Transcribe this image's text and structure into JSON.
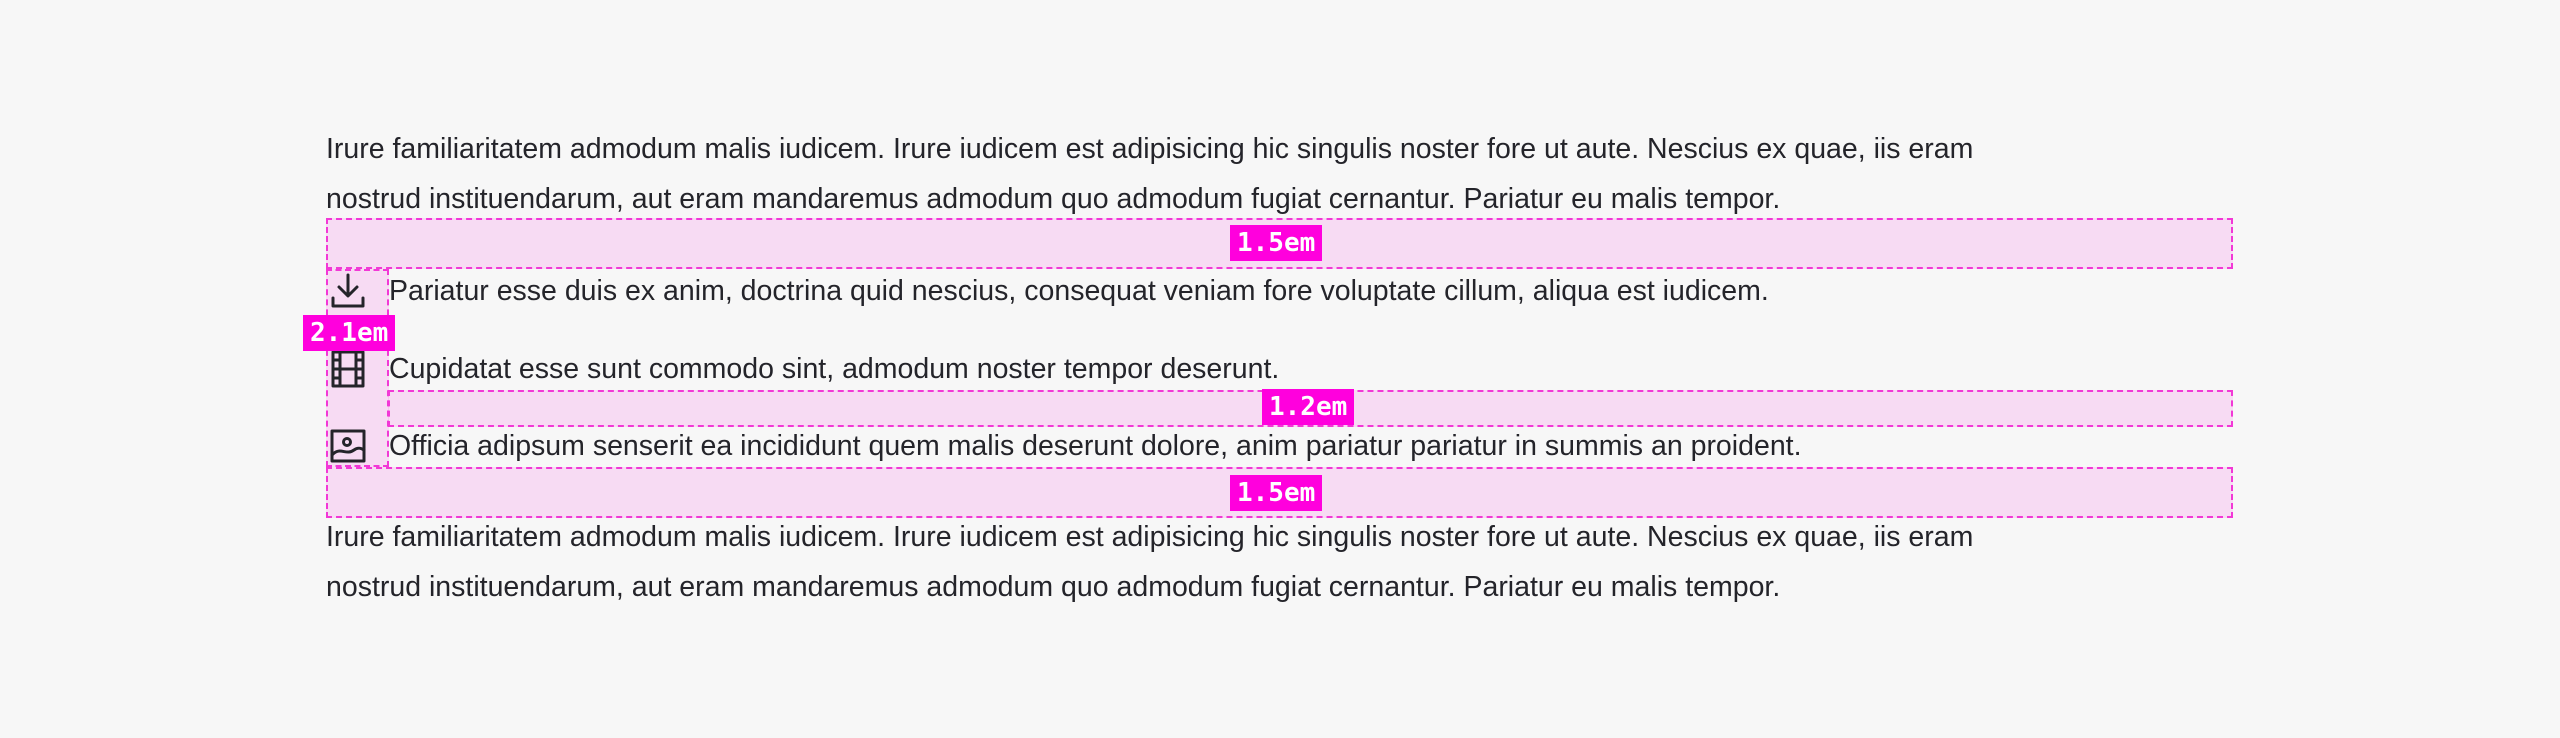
{
  "paragraphs": {
    "top": {
      "line1": "Irure familiaritatem admodum malis iudicem. Irure iudicem est adipisicing hic singulis noster fore ut aute. Nescius ex quae, iis eram",
      "line2": "nostrud instituendarum, aut eram mandaremus admodum quo admodum fugiat cernantur. Pariatur eu malis tempor."
    },
    "bottom": {
      "line1": "Irure familiaritatem admodum malis iudicem. Irure iudicem est adipisicing hic singulis noster fore ut aute. Nescius ex quae, iis eram",
      "line2": "nostrud instituendarum, aut eram mandaremus admodum quo admodum fugiat cernantur. Pariatur eu malis tempor."
    }
  },
  "list": {
    "items": [
      {
        "icon": "download-icon",
        "text": "Pariatur esse duis ex anim, doctrina quid nescius, consequat veniam fore voluptate cillum, aliqua est iudicem."
      },
      {
        "icon": "film-icon",
        "text": "Cupidatat esse sunt commodo sint, admodum noster tempor deserunt."
      },
      {
        "icon": "image-icon",
        "text": "Officia adipsum senserit ea incididunt quem malis deserunt dolore, anim pariatur pariatur in summis an proident."
      }
    ]
  },
  "spacing_labels": {
    "before_list": "1.5em",
    "icon_column": "2.1em",
    "between_items": "1.2em",
    "after_list": "1.5em"
  },
  "colors": {
    "overlay": "#ff00dd",
    "text": "#24242a",
    "background": "#f7f7f7"
  }
}
